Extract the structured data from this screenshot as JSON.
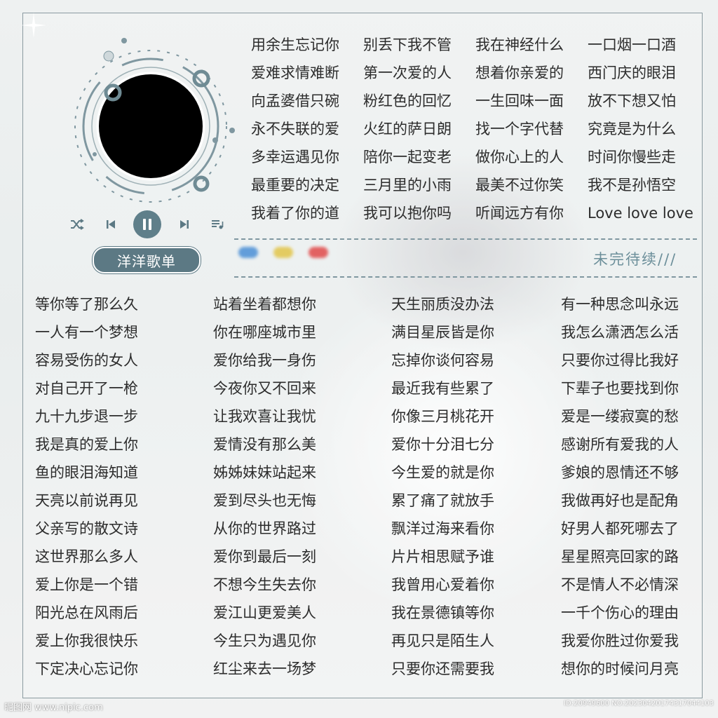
{
  "player": {
    "playlist_label": "洋洋歌单",
    "colors": {
      "accent": "#5c7984",
      "ring": "#7f97a0",
      "disc": "#000000"
    },
    "icons": [
      "shuffle-icon",
      "previous-icon",
      "pause-icon",
      "next-icon",
      "playlist-icon"
    ]
  },
  "top_songs": [
    "用余生忘记你",
    "别丢下我不管",
    "我在神经什么",
    "一口烟一口酒",
    "爱难求情难断",
    "第一次爱的人",
    "想着你亲爱的",
    "西门庆的眼泪",
    "向孟婆借只碗",
    "粉红色的回忆",
    "一生回味一面",
    "放不下想又怕",
    "永不失联的爱",
    "火红的萨日朗",
    "找一个字代替",
    "究竟是为什么",
    "多幸运遇见你",
    "陪你一起变老",
    "做你心上的人",
    "时间你慢些走",
    "最重要的决定",
    "三月里的小雨",
    "最美不过你笑",
    "我不是孙悟空",
    "我着了你的道",
    "我可以抱你吗",
    "听闻远方有你",
    "Love love love"
  ],
  "to_be_continued": "未完待续///",
  "bottom_songs": [
    "等你等了那么久",
    "站着坐着都想你",
    "天生丽质没办法",
    "有一种思念叫永远",
    "一人有一个梦想",
    "你在哪座城市里",
    "满目星辰皆是你",
    "我怎么潇洒怎么活",
    "容易受伤的女人",
    "爱你给我一身伤",
    "忘掉你谈何容易",
    "只要你过得比我好",
    "对自己开了一枪",
    "今夜你又不回来",
    "最近我有些累了",
    "下辈子也要找到你",
    "九十九步退一步",
    "让我欢喜让我忧",
    "你像三月桃花开",
    "爱是一缕寂寞的愁",
    "我是真的爱上你",
    "爱情没有那么美",
    "爱你十分泪七分",
    "感谢所有爱我的人",
    "鱼的眼泪海知道",
    "姊姊妹妹站起来",
    "今生爱的就是你",
    "爹娘的恩情还不够",
    "天亮以前说再见",
    "爱到尽头也无悔",
    "累了痛了就放手",
    "我做再好也是配角",
    "父亲写的散文诗",
    "从你的世界路过",
    "飘洋过海来看你",
    "好男人都死哪去了",
    "这世界那么多人",
    "爱你到最后一刻",
    "片片相思赋予谁",
    "星星照亮回家的路",
    "爱上你是一个错",
    "不想今生失去你",
    "我曾用心爱着你",
    "不是情人不必情深",
    "阳光总在风雨后",
    "爱江山更爱美人",
    "我在景德镇等你",
    "一千个伤心的理由",
    "爱上你我很快乐",
    "今生只为遇见你",
    "再见只是陌生人",
    "我爱你胜过你爱我",
    "下定决心忘记你",
    "红尘来去一场梦",
    "只要你还需要我",
    "想你的时候问月亮"
  ],
  "watermark": {
    "left": "昵图网 www.nipic.com",
    "right": "ID:20949600 NO:20230420174317044103"
  }
}
